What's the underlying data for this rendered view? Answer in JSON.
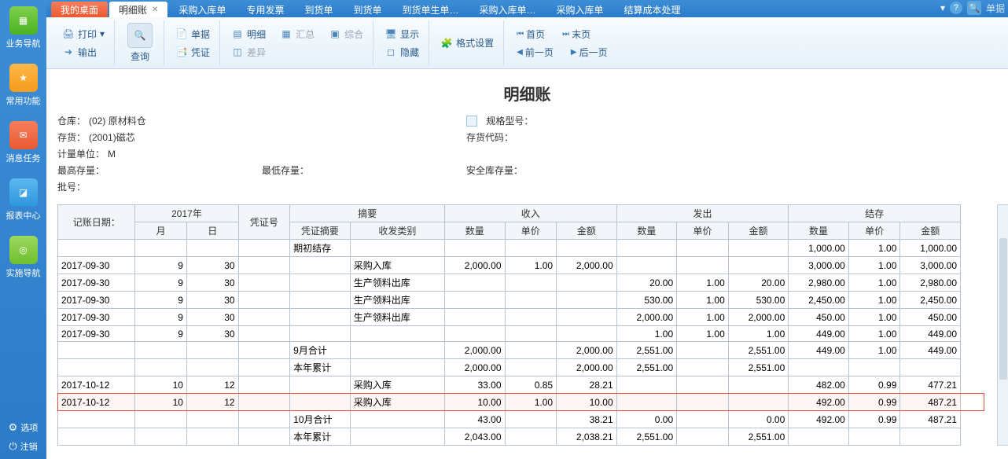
{
  "sidebar": {
    "items": [
      {
        "label": "业务导航"
      },
      {
        "label": "常用功能"
      },
      {
        "label": "消息任务"
      },
      {
        "label": "报表中心"
      },
      {
        "label": "实施导航"
      }
    ],
    "options": "选项",
    "logout": "注销"
  },
  "tabs": {
    "my_desktop": "我的桌面",
    "list": [
      {
        "label": "明细账",
        "active": true,
        "closable": true
      },
      {
        "label": "采购入库单"
      },
      {
        "label": "专用发票"
      },
      {
        "label": "到货单"
      },
      {
        "label": "到货单"
      },
      {
        "label": "到货单生单…"
      },
      {
        "label": "采购入库单…"
      },
      {
        "label": "采购入库单"
      },
      {
        "label": "结算成本处理"
      }
    ],
    "search_hint": "单据"
  },
  "toolbar": {
    "print": "打印",
    "export": "输出",
    "query": "查询",
    "single_doc": "单据",
    "voucher": "凭证",
    "detail": "明细",
    "summary": "汇总",
    "comprehensive": "综合",
    "diff": "差异",
    "show": "显示",
    "hide": "隐藏",
    "format": "格式设置",
    "first": "首页",
    "prev": "前一页",
    "next": "后一页",
    "last": "末页"
  },
  "page": {
    "title": "明细账",
    "meta": {
      "warehouse_label": "仓库：",
      "warehouse": "(02) 原材料仓",
      "inventory_label": "存货：",
      "inventory": "(2001)磁芯",
      "unit_label": "计量单位：",
      "unit": "M",
      "max_label": "最高存量：",
      "max": "",
      "min_label": "最低存量：",
      "min": "",
      "safe_label": "安全库存量：",
      "safe": "",
      "batch_label": "批号：",
      "spec_label": "规格型号：",
      "code_label": "存货代码："
    }
  },
  "table": {
    "headers": {
      "date": "记账日期：",
      "year": "2017年",
      "month": "月",
      "day": "日",
      "voucher_no": "凭证号",
      "summary": "摘要",
      "voucher_sum": "凭证摘要",
      "io_type": "收发类别",
      "in": "收入",
      "out": "发出",
      "balance": "结存",
      "qty": "数量",
      "price": "单价",
      "amount": "金额"
    },
    "rows": [
      {
        "date": "",
        "m": "",
        "d": "",
        "vs": "期初结存",
        "io": "",
        "iq": "",
        "ip": "",
        "ia": "",
        "oq": "",
        "op": "",
        "oa": "",
        "bq": "1,000.00",
        "bp": "1.00",
        "ba": "1,000.00"
      },
      {
        "date": "2017-09-30",
        "m": "9",
        "d": "30",
        "vs": "",
        "io": "采购入库",
        "iq": "2,000.00",
        "ip": "1.00",
        "ia": "2,000.00",
        "oq": "",
        "op": "",
        "oa": "",
        "bq": "3,000.00",
        "bp": "1.00",
        "ba": "3,000.00"
      },
      {
        "date": "2017-09-30",
        "m": "9",
        "d": "30",
        "vs": "",
        "io": "生产领料出库",
        "iq": "",
        "ip": "",
        "ia": "",
        "oq": "20.00",
        "op": "1.00",
        "oa": "20.00",
        "bq": "2,980.00",
        "bp": "1.00",
        "ba": "2,980.00"
      },
      {
        "date": "2017-09-30",
        "m": "9",
        "d": "30",
        "vs": "",
        "io": "生产领料出库",
        "iq": "",
        "ip": "",
        "ia": "",
        "oq": "530.00",
        "op": "1.00",
        "oa": "530.00",
        "bq": "2,450.00",
        "bp": "1.00",
        "ba": "2,450.00"
      },
      {
        "date": "2017-09-30",
        "m": "9",
        "d": "30",
        "vs": "",
        "io": "生产领料出库",
        "iq": "",
        "ip": "",
        "ia": "",
        "oq": "2,000.00",
        "op": "1.00",
        "oa": "2,000.00",
        "bq": "450.00",
        "bp": "1.00",
        "ba": "450.00"
      },
      {
        "date": "2017-09-30",
        "m": "9",
        "d": "30",
        "vs": "",
        "io": "",
        "iq": "",
        "ip": "",
        "ia": "",
        "oq": "1.00",
        "op": "1.00",
        "oa": "1.00",
        "bq": "449.00",
        "bp": "1.00",
        "ba": "449.00"
      },
      {
        "date": "",
        "m": "",
        "d": "",
        "vs": "9月合计",
        "io": "",
        "iq": "2,000.00",
        "ip": "",
        "ia": "2,000.00",
        "oq": "2,551.00",
        "op": "",
        "oa": "2,551.00",
        "bq": "449.00",
        "bp": "1.00",
        "ba": "449.00"
      },
      {
        "date": "",
        "m": "",
        "d": "",
        "vs": "本年累计",
        "io": "",
        "iq": "2,000.00",
        "ip": "",
        "ia": "2,000.00",
        "oq": "2,551.00",
        "op": "",
        "oa": "2,551.00",
        "bq": "",
        "bp": "",
        "ba": ""
      },
      {
        "date": "2017-10-12",
        "m": "10",
        "d": "12",
        "vs": "",
        "io": "采购入库",
        "iq": "33.00",
        "ip": "0.85",
        "ia": "28.21",
        "oq": "",
        "op": "",
        "oa": "",
        "bq": "482.00",
        "bp": "0.99",
        "ba": "477.21"
      },
      {
        "date": "2017-10-12",
        "m": "10",
        "d": "12",
        "vs": "",
        "io": "采购入库",
        "iq": "10.00",
        "ip": "1.00",
        "ia": "10.00",
        "oq": "",
        "op": "",
        "oa": "",
        "bq": "492.00",
        "bp": "0.99",
        "ba": "487.21",
        "hl": true
      },
      {
        "date": "",
        "m": "",
        "d": "",
        "vs": "10月合计",
        "io": "",
        "iq": "43.00",
        "ip": "",
        "ia": "38.21",
        "oq": "0.00",
        "op": "",
        "oa": "0.00",
        "bq": "492.00",
        "bp": "0.99",
        "ba": "487.21"
      },
      {
        "date": "",
        "m": "",
        "d": "",
        "vs": "本年累计",
        "io": "",
        "iq": "2,043.00",
        "ip": "",
        "ia": "2,038.21",
        "oq": "2,551.00",
        "op": "",
        "oa": "2,551.00",
        "bq": "",
        "bp": "",
        "ba": ""
      }
    ]
  }
}
